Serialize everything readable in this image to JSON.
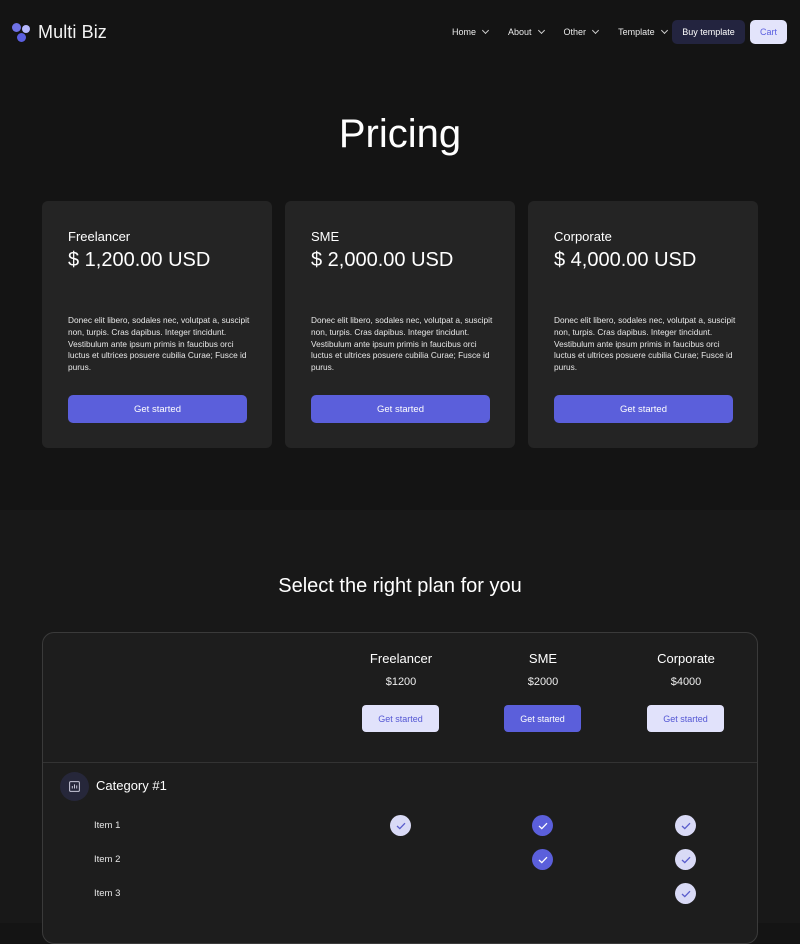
{
  "colors": {
    "accent": "#5b5fdb",
    "accent_light": "#e1e2fb",
    "background": "#141414",
    "card": "#242424"
  },
  "brand": {
    "name": "Multi Biz",
    "icon": "logo-dots-icon"
  },
  "nav": {
    "links": [
      {
        "label": "Home",
        "icon": "chevron-down-icon"
      },
      {
        "label": "About",
        "icon": "chevron-down-icon"
      },
      {
        "label": "Other",
        "icon": "chevron-down-icon"
      },
      {
        "label": "Template",
        "icon": "chevron-down-icon"
      }
    ],
    "buy_label": "Buy template",
    "cart_label": "Cart"
  },
  "pricing": {
    "title": "Pricing",
    "cards": [
      {
        "name": "Freelancer",
        "price": "$ 1,200.00 USD",
        "description": "Donec elit libero, sodales nec, volutpat a, suscipit non, turpis. Cras dapibus. Integer tincidunt. Vestibulum ante ipsum primis in faucibus orci luctus et ultrices posuere cubilia Curae; Fusce id purus.",
        "button": "Get started"
      },
      {
        "name": "SME",
        "price": "$ 2,000.00 USD",
        "description": "Donec elit libero, sodales nec, volutpat a, suscipit non, turpis. Cras dapibus. Integer tincidunt. Vestibulum ante ipsum primis in faucibus orci luctus et ultrices posuere cubilia Curae; Fusce id purus.",
        "button": "Get started"
      },
      {
        "name": "Corporate",
        "price": "$ 4,000.00 USD",
        "description": "Donec elit libero, sodales nec, volutpat a, suscipit non, turpis. Cras dapibus. Integer tincidunt. Vestibulum ante ipsum primis in faucibus orci luctus et ultrices posuere cubilia Curae; Fusce id purus.",
        "button": "Get started"
      }
    ]
  },
  "compare": {
    "title": "Select the right plan for you",
    "plans": [
      {
        "name": "Freelancer",
        "price": "$1200",
        "button": "Get started",
        "style": "light"
      },
      {
        "name": "SME",
        "price": "$2000",
        "button": "Get started",
        "style": "solid"
      },
      {
        "name": "Corporate",
        "price": "$4000",
        "button": "Get started",
        "style": "light"
      }
    ],
    "category": {
      "label": "Category #1",
      "icon": "bar-chart-icon"
    },
    "items": [
      {
        "label": "Item 1",
        "checks": [
          "light",
          "solid",
          "light"
        ]
      },
      {
        "label": "Item 2",
        "checks": [
          null,
          "solid",
          "light"
        ]
      },
      {
        "label": "Item 3",
        "checks": [
          null,
          null,
          "light"
        ]
      }
    ],
    "check_icon": "checkmark-icon"
  }
}
